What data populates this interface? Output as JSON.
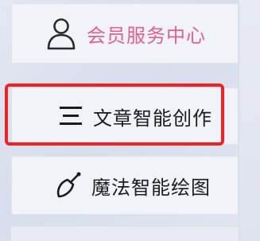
{
  "menu": {
    "items": [
      {
        "label": "会员服务中心",
        "icon": "user-icon",
        "color": "#e0628c"
      },
      {
        "label": "文章智能创作",
        "icon": "menu-lines-icon",
        "color": "#1b1b1b"
      },
      {
        "label": "魔法智能绘图",
        "icon": "brush-icon",
        "color": "#1b1b1b"
      }
    ],
    "highlight_color": "#ee2222"
  }
}
